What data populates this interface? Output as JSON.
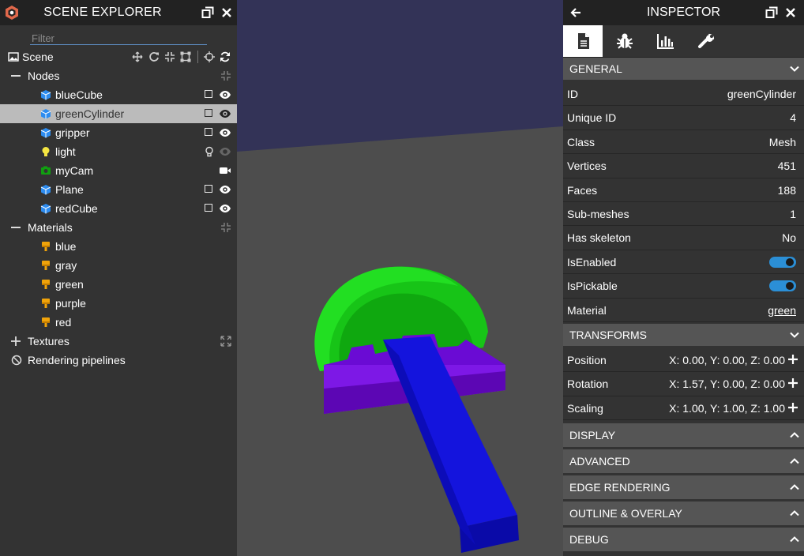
{
  "explorer": {
    "title": "SCENE EXPLORER",
    "filter_placeholder": "Filter",
    "scene_label": "Scene",
    "nodes_label": "Nodes",
    "nodes": [
      {
        "name": "blueCube",
        "type": "mesh"
      },
      {
        "name": "greenCylinder",
        "type": "mesh",
        "selected": true
      },
      {
        "name": "gripper",
        "type": "mesh"
      },
      {
        "name": "light",
        "type": "light"
      },
      {
        "name": "myCam",
        "type": "camera"
      },
      {
        "name": "Plane",
        "type": "mesh"
      },
      {
        "name": "redCube",
        "type": "mesh"
      }
    ],
    "materials_label": "Materials",
    "materials": [
      "blue",
      "gray",
      "green",
      "purple",
      "red"
    ],
    "textures_label": "Textures",
    "pipelines_label": "Rendering pipelines"
  },
  "inspector": {
    "title": "INSPECTOR",
    "general_label": "GENERAL",
    "properties": [
      {
        "key": "ID",
        "value": "greenCylinder"
      },
      {
        "key": "Unique ID",
        "value": "4"
      },
      {
        "key": "Class",
        "value": "Mesh"
      },
      {
        "key": "Vertices",
        "value": "451"
      },
      {
        "key": "Faces",
        "value": "188"
      },
      {
        "key": "Sub-meshes",
        "value": "1"
      },
      {
        "key": "Has skeleton",
        "value": "No"
      }
    ],
    "isenabled_label": "IsEnabled",
    "ispickable_label": "IsPickable",
    "material_label": "Material",
    "material_value": "green",
    "transforms_label": "TRANSFORMS",
    "transforms": [
      {
        "key": "Position",
        "value": "X: 0.00, Y: 0.00, Z: 0.00"
      },
      {
        "key": "Rotation",
        "value": "X: 1.57, Y: 0.00, Z: 0.00"
      },
      {
        "key": "Scaling",
        "value": "X: 1.00, Y: 1.00, Z: 1.00"
      }
    ],
    "collapsed_sections": [
      "DISPLAY",
      "ADVANCED",
      "EDGE RENDERING",
      "OUTLINE & OVERLAY",
      "DEBUG"
    ]
  },
  "colors": {
    "accent": "#2b8fd6",
    "mesh_icon": "#2d8cf0",
    "material_icon": "#f0a30a",
    "camera_icon": "#10a010",
    "light_icon": "#f5e642"
  }
}
